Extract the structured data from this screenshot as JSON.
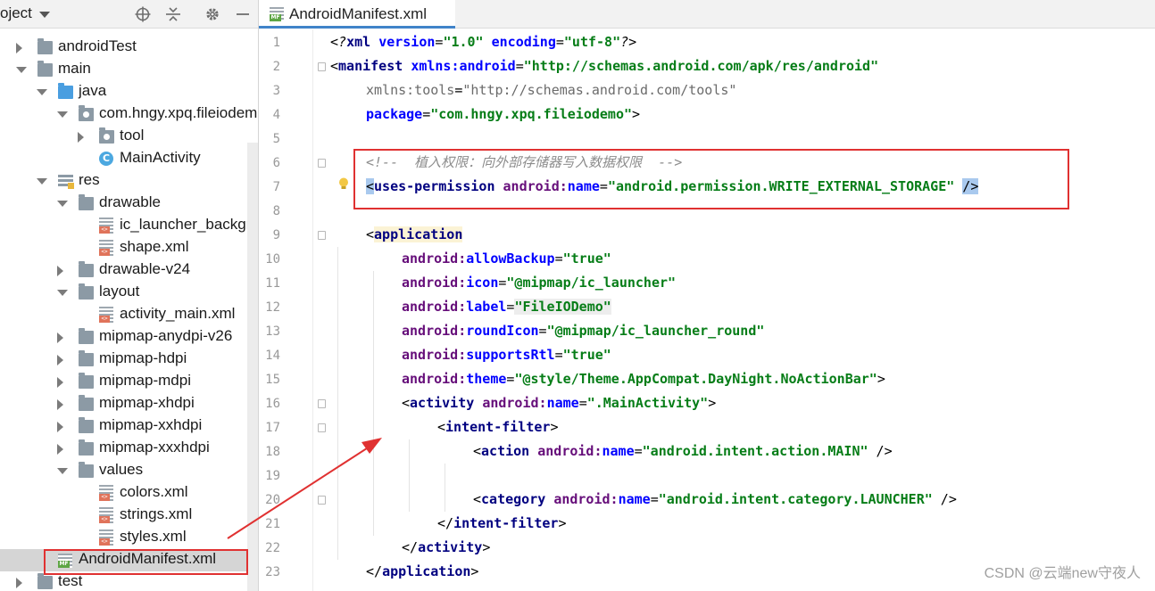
{
  "panel": {
    "title": "oject",
    "tree": [
      {
        "label": "androidTest",
        "depth": 1,
        "arrow": "right",
        "icon": "folder-icon"
      },
      {
        "label": "main",
        "depth": 1,
        "arrow": "down",
        "icon": "folder-icon"
      },
      {
        "label": "java",
        "depth": 2,
        "arrow": "down",
        "icon": "source-folder-icon"
      },
      {
        "label": "com.hngy.xpq.fileiodem",
        "depth": 3,
        "arrow": "down",
        "icon": "package-icon"
      },
      {
        "label": "tool",
        "depth": 4,
        "arrow": "right",
        "icon": "package-icon"
      },
      {
        "label": "MainActivity",
        "depth": 4,
        "arrow": "",
        "icon": "class-icon"
      },
      {
        "label": "res",
        "depth": 2,
        "arrow": "down",
        "icon": "resources-folder-icon"
      },
      {
        "label": "drawable",
        "depth": 3,
        "arrow": "down",
        "icon": "folder-icon"
      },
      {
        "label": "ic_launcher_backgro",
        "depth": 4,
        "arrow": "",
        "icon": "xml-file-icon"
      },
      {
        "label": "shape.xml",
        "depth": 4,
        "arrow": "",
        "icon": "xml-file-icon"
      },
      {
        "label": "drawable-v24",
        "depth": 3,
        "arrow": "right",
        "icon": "folder-icon"
      },
      {
        "label": "layout",
        "depth": 3,
        "arrow": "down",
        "icon": "folder-icon"
      },
      {
        "label": "activity_main.xml",
        "depth": 4,
        "arrow": "",
        "icon": "xml-file-icon"
      },
      {
        "label": "mipmap-anydpi-v26",
        "depth": 3,
        "arrow": "right",
        "icon": "folder-icon"
      },
      {
        "label": "mipmap-hdpi",
        "depth": 3,
        "arrow": "right",
        "icon": "folder-icon"
      },
      {
        "label": "mipmap-mdpi",
        "depth": 3,
        "arrow": "right",
        "icon": "folder-icon"
      },
      {
        "label": "mipmap-xhdpi",
        "depth": 3,
        "arrow": "right",
        "icon": "folder-icon"
      },
      {
        "label": "mipmap-xxhdpi",
        "depth": 3,
        "arrow": "right",
        "icon": "folder-icon"
      },
      {
        "label": "mipmap-xxxhdpi",
        "depth": 3,
        "arrow": "right",
        "icon": "folder-icon"
      },
      {
        "label": "values",
        "depth": 3,
        "arrow": "down",
        "icon": "folder-icon"
      },
      {
        "label": "colors.xml",
        "depth": 4,
        "arrow": "",
        "icon": "xml-file-icon"
      },
      {
        "label": "strings.xml",
        "depth": 4,
        "arrow": "",
        "icon": "xml-file-icon"
      },
      {
        "label": "styles.xml",
        "depth": 4,
        "arrow": "",
        "icon": "xml-file-icon"
      },
      {
        "label": "AndroidManifest.xml",
        "depth": 2,
        "arrow": "",
        "icon": "manifest-file-icon",
        "selected": true
      },
      {
        "label": "test",
        "depth": 1,
        "arrow": "right",
        "icon": "folder-icon"
      }
    ]
  },
  "editor": {
    "tab_label": "AndroidManifest.xml",
    "line_numbers": [
      "1",
      "2",
      "3",
      "4",
      "5",
      "6",
      "7",
      "8",
      "9",
      "10",
      "11",
      "12",
      "13",
      "14",
      "15",
      "16",
      "17",
      "18",
      "19",
      "20",
      "21",
      "22",
      "23"
    ],
    "lines": [
      {
        "indent": 0,
        "parts": [
          [
            "pi",
            "<?"
          ],
          [
            "t",
            "xml "
          ],
          [
            "a",
            "version"
          ],
          [
            "plain",
            "="
          ],
          [
            "v",
            "\"1.0\""
          ],
          [
            "plain",
            " "
          ],
          [
            "a",
            "encoding"
          ],
          [
            "plain",
            "="
          ],
          [
            "v",
            "\"utf-8\""
          ],
          [
            "pi",
            "?>"
          ]
        ]
      },
      {
        "indent": 0,
        "parts": [
          [
            "plain",
            "<"
          ],
          [
            "t",
            "manifest "
          ],
          [
            "a",
            "xmlns:android"
          ],
          [
            "plain",
            "="
          ],
          [
            "v",
            "\"http://schemas.android.com/apk/res/android\""
          ]
        ]
      },
      {
        "indent": 1,
        "parts": [
          [
            "gray2",
            "xmlns:tools"
          ],
          [
            "plain2",
            "="
          ],
          [
            "gray2",
            "\"http://schemas.android.com/tools\""
          ]
        ]
      },
      {
        "indent": 1,
        "parts": [
          [
            "a",
            "package"
          ],
          [
            "plain",
            "="
          ],
          [
            "v",
            "\"com.hngy.xpq.fileiodemo\""
          ],
          [
            "plain",
            ">"
          ]
        ]
      },
      {
        "indent": 0,
        "parts": []
      },
      {
        "indent": 1,
        "parts": [
          [
            "gray",
            "<!--  植入权限：向外部存储器写入数据权限  -->"
          ]
        ]
      },
      {
        "indent": 1,
        "parts": [
          [
            "hl-blue",
            "<"
          ],
          [
            "t",
            "uses-permission "
          ],
          [
            "ns",
            "android:"
          ],
          [
            "a",
            "name"
          ],
          [
            "plain",
            "="
          ],
          [
            "v",
            "\"android.permission.WRITE_EXTERNAL_STORAGE\""
          ],
          [
            "plain",
            " "
          ],
          [
            "hl-blue",
            "/>"
          ]
        ]
      },
      {
        "indent": 0,
        "parts": []
      },
      {
        "indent": 1,
        "parts": [
          [
            "plain",
            "<"
          ],
          [
            "t-hl",
            "application"
          ]
        ]
      },
      {
        "indent": 2,
        "parts": [
          [
            "ns",
            "android:"
          ],
          [
            "a",
            "allowBackup"
          ],
          [
            "plain",
            "="
          ],
          [
            "v",
            "\"true\""
          ]
        ]
      },
      {
        "indent": 2,
        "parts": [
          [
            "ns",
            "android:"
          ],
          [
            "a",
            "icon"
          ],
          [
            "plain",
            "="
          ],
          [
            "v",
            "\"@mipmap/ic_launcher\""
          ]
        ]
      },
      {
        "indent": 2,
        "parts": [
          [
            "ns",
            "android:"
          ],
          [
            "a",
            "label"
          ],
          [
            "plain",
            "="
          ],
          [
            "v-gray",
            "\"FileIODemo\""
          ]
        ]
      },
      {
        "indent": 2,
        "parts": [
          [
            "ns",
            "android:"
          ],
          [
            "a",
            "roundIcon"
          ],
          [
            "plain",
            "="
          ],
          [
            "v",
            "\"@mipmap/ic_launcher_round\""
          ]
        ]
      },
      {
        "indent": 2,
        "parts": [
          [
            "ns",
            "android:"
          ],
          [
            "a",
            "supportsRtl"
          ],
          [
            "plain",
            "="
          ],
          [
            "v",
            "\"true\""
          ]
        ]
      },
      {
        "indent": 2,
        "parts": [
          [
            "ns",
            "android:"
          ],
          [
            "a",
            "theme"
          ],
          [
            "plain",
            "="
          ],
          [
            "v",
            "\"@style/Theme.AppCompat.DayNight.NoActionBar\""
          ],
          [
            "plain",
            ">"
          ]
        ]
      },
      {
        "indent": 2,
        "parts": [
          [
            "plain",
            "<"
          ],
          [
            "t",
            "activity "
          ],
          [
            "ns",
            "android:"
          ],
          [
            "a",
            "name"
          ],
          [
            "plain",
            "="
          ],
          [
            "v",
            "\".MainActivity\""
          ],
          [
            "plain",
            ">"
          ]
        ]
      },
      {
        "indent": 3,
        "parts": [
          [
            "plain",
            "<"
          ],
          [
            "t",
            "intent-filter"
          ],
          [
            "plain",
            ">"
          ]
        ]
      },
      {
        "indent": 4,
        "parts": [
          [
            "plain",
            "<"
          ],
          [
            "t",
            "action "
          ],
          [
            "ns",
            "android:"
          ],
          [
            "a",
            "name"
          ],
          [
            "plain",
            "="
          ],
          [
            "v",
            "\"android.intent.action.MAIN\""
          ],
          [
            "plain",
            " />"
          ]
        ]
      },
      {
        "indent": 0,
        "parts": []
      },
      {
        "indent": 4,
        "parts": [
          [
            "plain",
            "<"
          ],
          [
            "t",
            "category "
          ],
          [
            "ns",
            "android:"
          ],
          [
            "a",
            "name"
          ],
          [
            "plain",
            "="
          ],
          [
            "v",
            "\"android.intent.category.LAUNCHER\""
          ],
          [
            "plain",
            " />"
          ]
        ]
      },
      {
        "indent": 3,
        "parts": [
          [
            "plain",
            "</"
          ],
          [
            "t",
            "intent-filter"
          ],
          [
            "plain",
            ">"
          ]
        ]
      },
      {
        "indent": 2,
        "parts": [
          [
            "plain",
            "</"
          ],
          [
            "t",
            "activity"
          ],
          [
            "plain",
            ">"
          ]
        ]
      },
      {
        "indent": 1,
        "parts": [
          [
            "plain",
            "</"
          ],
          [
            "t",
            "application"
          ],
          [
            "plain",
            ">"
          ]
        ]
      }
    ]
  },
  "watermark": "CSDN @云端new守夜人",
  "colors": {
    "annotation_red": "#e03131",
    "tab_underline": "#4083c9"
  }
}
